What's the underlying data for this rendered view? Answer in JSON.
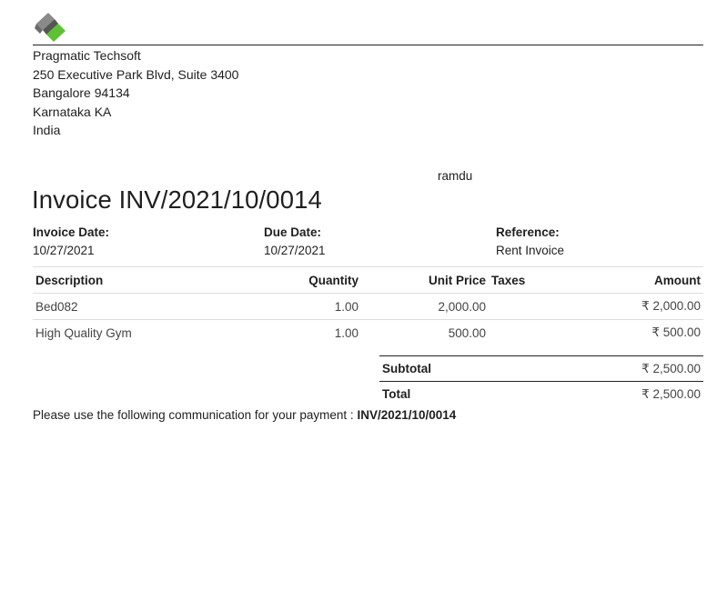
{
  "company": {
    "name": "Pragmatic Techsoft",
    "street": "250 Executive Park Blvd, Suite 3400",
    "city_zip": "Bangalore 94134",
    "state": "Karnataka KA",
    "country": "India",
    "logo_icon": "pragmatic-logo-icon",
    "logo_colors": {
      "green": "#5cc234",
      "gray": "#8a8a8a",
      "dark": "#555555"
    }
  },
  "partner_name": "ramdu",
  "invoice": {
    "title": "Invoice INV/2021/10/0014",
    "date_label": "Invoice Date:",
    "date_value": "10/27/2021",
    "due_label": "Due Date:",
    "due_value": "10/27/2021",
    "ref_label": "Reference:",
    "ref_value": "Rent Invoice"
  },
  "lines": {
    "headers": [
      "Description",
      "Quantity",
      "Unit Price",
      "Taxes",
      "Amount"
    ],
    "rows": [
      {
        "description": "Bed082",
        "quantity": "1.00",
        "unit_price": "2,000.00",
        "taxes": "",
        "amount": "₹ 2,000.00"
      },
      {
        "description": "High Quality Gym",
        "quantity": "1.00",
        "unit_price": "500.00",
        "taxes": "",
        "amount": "₹ 500.00"
      }
    ]
  },
  "totals": {
    "subtotal_label": "Subtotal",
    "subtotal_value": "₹ 2,500.00",
    "total_label": "Total",
    "total_value": "₹ 2,500.00"
  },
  "communication": {
    "text": "Please use the following communication for your payment : ",
    "reference": "INV/2021/10/0014"
  }
}
